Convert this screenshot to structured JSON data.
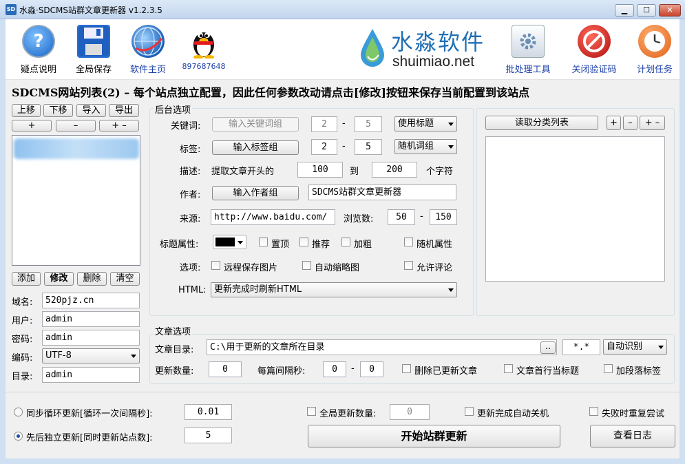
{
  "window": {
    "title": "水淼·SDCMS站群文章更新器 v1.2.3.5",
    "icon_text": "SD"
  },
  "window_controls": {
    "minimize": "▁",
    "maximize": "☐",
    "close": "✕"
  },
  "toolbar": {
    "faq": {
      "label": "疑点说明",
      "icon": "help-icon"
    },
    "save": {
      "label": "全局保存",
      "icon": "floppy-icon"
    },
    "home": {
      "label": "软件主页",
      "icon": "globe-icon"
    },
    "qq": {
      "label": "897687648",
      "icon": "qq-penguin-icon"
    },
    "batch": {
      "label": "批处理工具",
      "icon": "gear-icon"
    },
    "captcha": {
      "label": "关闭验证码",
      "icon": "no-entry-icon"
    },
    "schedule": {
      "label": "计划任务",
      "icon": "clock-icon"
    }
  },
  "brand": {
    "cn": "水淼软件",
    "en": "shuimiao.net"
  },
  "heading": "SDCMS网站列表(2) – 每个站点独立配置，因此任何参数改动请点击[修改]按钮来保存当前配置到该站点",
  "site_list": {
    "up": "上移",
    "down": "下移",
    "import": "导入",
    "export": "导出",
    "plus": "+",
    "minus": "–",
    "plusminus": "+ –",
    "add": "添加",
    "modify": "修改",
    "delete": "删除",
    "clear": "清空"
  },
  "site_fields": {
    "domain_label": "域名:",
    "domain": "520pjz.cn",
    "user_label": "用户:",
    "user": "admin",
    "password_label": "密码:",
    "password": "admin",
    "encoding_label": "编码:",
    "encoding": "UTF-8",
    "dir_label": "目录:",
    "dir": "admin"
  },
  "backend": {
    "title": "后台选项",
    "keyword_label": "关键词:",
    "keyword_btn": "输入关键词组",
    "keyword_min": "2",
    "keyword_dash": "-",
    "keyword_max": "5",
    "keyword_mode": "使用标题",
    "tag_label": "标签:",
    "tag_btn": "输入标签组",
    "tag_min": "2",
    "tag_dash": "-",
    "tag_max": "5",
    "tag_mode": "随机词组",
    "desc_label": "描述:",
    "desc_prefix": "提取文章开头的",
    "desc_min": "100",
    "desc_to": "到",
    "desc_max": "200",
    "desc_suffix": "个字符",
    "author_label": "作者:",
    "author_btn": "输入作者组",
    "author_value": "SDCMS站群文章更新器",
    "source_label": "来源:",
    "source_value": "http://www.baidu.com/",
    "views_label": "浏览数:",
    "views_min": "50",
    "views_dash": "-",
    "views_max": "150",
    "title_attr_label": "标题属性:",
    "title_color": "#000000",
    "top": "置顶",
    "recommend": "推荐",
    "bold": "加粗",
    "random_attr": "随机属性",
    "options_label": "选项:",
    "remote_img": "远程保存图片",
    "auto_thumb": "自动缩略图",
    "allow_comment": "允许评论",
    "html_label": "HTML:",
    "html_mode": "更新完成时刷新HTML"
  },
  "category": {
    "read_btn": "读取分类列表",
    "plus": "+",
    "minus": "–",
    "plusminus": "+ –"
  },
  "article": {
    "title": "文章选项",
    "dir_label": "文章目录:",
    "dir_value": "C:\\用于更新的文章所在目录",
    "browse": "..",
    "filter": "*.*",
    "detect": "自动识别",
    "count_label": "更新数量:",
    "count": "0",
    "interval_label": "每篇间隔秒:",
    "interval_min": "0",
    "interval_dash": "-",
    "interval_max": "0",
    "delete_updated": "删除已更新文章",
    "first_line_title": "文章首行当标题",
    "add_p_tags": "加段落标签"
  },
  "bottom": {
    "sync_label": "同步循环更新[循环一次间隔秒]:",
    "sync_value": "0.01",
    "seq_label": "先后独立更新[同时更新站点数]:",
    "seq_value": "5",
    "global_count_label": "全局更新数量:",
    "global_count": "0",
    "auto_shutdown": "更新完成自动关机",
    "retry": "失败时重复尝试",
    "start": "开始站群更新",
    "log": "查看日志"
  },
  "colors": {
    "accent": "#1f6fb6",
    "toolbar_link": "#1a3fa8"
  }
}
